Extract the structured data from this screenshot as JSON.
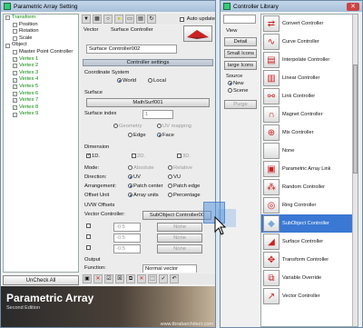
{
  "left_window": {
    "title": "Parametric Array Setting",
    "tree": [
      {
        "label": "Transform",
        "indent": 0,
        "green": true,
        "sel": false,
        "box": "-"
      },
      {
        "label": "Position",
        "indent": 1,
        "green": false,
        "sel": false,
        "box": ""
      },
      {
        "label": "Rotation",
        "indent": 1,
        "green": false,
        "sel": false,
        "box": ""
      },
      {
        "label": "Scale",
        "indent": 1,
        "green": false,
        "sel": false,
        "box": ""
      },
      {
        "label": "Object",
        "indent": 0,
        "green": false,
        "sel": false,
        "box": ""
      },
      {
        "label": "Master Point Controller",
        "indent": 1,
        "green": false,
        "sel": false,
        "box": ""
      },
      {
        "label": "Vertex 1",
        "indent": 1,
        "green": true,
        "sel": false,
        "box": "v"
      },
      {
        "label": "Vertex 2",
        "indent": 1,
        "green": true,
        "sel": false,
        "box": "v"
      },
      {
        "label": "Vertex 3",
        "indent": 1,
        "green": true,
        "sel": false,
        "box": "v"
      },
      {
        "label": "Vertex 4",
        "indent": 1,
        "green": true,
        "sel": false,
        "box": "v"
      },
      {
        "label": "Vertex 5",
        "indent": 1,
        "green": true,
        "sel": false,
        "box": "v"
      },
      {
        "label": "Vertex 6",
        "indent": 1,
        "green": true,
        "sel": false,
        "box": "v"
      },
      {
        "label": "Vertex 7",
        "indent": 1,
        "green": true,
        "sel": false,
        "box": "v"
      },
      {
        "label": "Vertex 8",
        "indent": 1,
        "green": true,
        "sel": false,
        "box": "v"
      },
      {
        "label": "Vertex 9",
        "indent": 1,
        "green": true,
        "sel": false,
        "box": "v"
      }
    ],
    "uncheck_all": "UnCheck All",
    "auto_update": "Auto update",
    "vector_label": "Vector",
    "controller_type": "Surface Controller",
    "controller_name": "Surface Controller002",
    "settings_header": "Controller settings",
    "coord_system": "Coordinate System",
    "coord_world": "World",
    "coord_local": "Local",
    "surface_label": "Surface",
    "surface_value": "MathSurf001",
    "surface_index_label": "Surface index",
    "surface_index_value": "1",
    "geometry": "Geometry",
    "uv_mapping": "UV mapping",
    "edge": "Edge",
    "face": "Face",
    "dimension_label": "Dimension",
    "dim_1d": "1D.",
    "dim_2d": "2D.",
    "dim_3d": "3D.",
    "mode_label": "Mode:",
    "mode_absolute": "Absolute",
    "mode_relative": "Relative",
    "direction_label": "Direction:",
    "dir_uv": "UV",
    "dir_vu": "VU",
    "arrangement_label": "Arrangement:",
    "arr_patch_center": "Patch center",
    "arr_patch_edge": "Patch edge",
    "offset_unit_label": "Offset Unit",
    "off_array_units": "Array units",
    "off_percentage": "Percentage",
    "uvw_offsets": "UVW Offsets",
    "vector_controller_label": "Vector Controller:",
    "vector_controller_value": "SubObject Controller00",
    "offset_rows": [
      {
        "value": "-0.5",
        "none": "None"
      },
      {
        "value": "-0.5",
        "none": "None"
      },
      {
        "value": "-0.5",
        "none": "None"
      }
    ],
    "output_label": "Output",
    "function_label": "Function:",
    "function_value": "Normal vector",
    "banner_title": "Parametric Array",
    "banner_edition": "Second Edition",
    "banner_url": "www.tbrabarchitect.com"
  },
  "right_window": {
    "title": "Controller Library",
    "view_label": "View",
    "detail_btn": "Detail",
    "small_icons_btn": "Small Icons",
    "large_icons_btn": "large Icons",
    "source_label": "Source",
    "source_new": "New",
    "source_scene": "Scene",
    "purge_btn": "Purge",
    "items": [
      {
        "label": "Convert Controller",
        "icon": "convert-controller-icon",
        "glyph": "⇄",
        "sel": false
      },
      {
        "label": "Curve Controller",
        "icon": "curve-controller-icon",
        "glyph": "∿",
        "sel": false
      },
      {
        "label": "Interpolate Controller",
        "icon": "interpolate-controller-icon",
        "glyph": "▤",
        "sel": false
      },
      {
        "label": "Linear Controller",
        "icon": "linear-controller-icon",
        "glyph": "▥",
        "sel": false
      },
      {
        "label": "Link Controller",
        "icon": "link-controller-icon",
        "glyph": "⚯",
        "sel": false
      },
      {
        "label": "Magnet Controller",
        "icon": "magnet-controller-icon",
        "glyph": "∩",
        "sel": false
      },
      {
        "label": "Mix Controller",
        "icon": "mix-controller-icon",
        "glyph": "⊕",
        "sel": false
      },
      {
        "label": "None",
        "icon": "none-controller-icon",
        "glyph": "",
        "sel": false
      },
      {
        "label": "Parametric Array Link",
        "icon": "parametric-array-link-icon",
        "glyph": "▣",
        "sel": false
      },
      {
        "label": "Random Controller",
        "icon": "random-controller-icon",
        "glyph": "⁂",
        "sel": false
      },
      {
        "label": "Ring Controller",
        "icon": "ring-controller-icon",
        "glyph": "◎",
        "sel": false
      },
      {
        "label": "SubObject Controller",
        "icon": "subobject-controller-icon",
        "glyph": "◆",
        "sel": true
      },
      {
        "label": "Surface Controller",
        "icon": "surface-controller-icon",
        "glyph": "◢",
        "sel": false
      },
      {
        "label": "Transform Controller",
        "icon": "transform-controller-icon",
        "glyph": "✥",
        "sel": false
      },
      {
        "label": "Variable Override",
        "icon": "variable-override-icon",
        "glyph": "⧉",
        "sel": false
      },
      {
        "label": "Vector Controller",
        "icon": "vector-controller-icon",
        "glyph": "↗",
        "sel": false
      }
    ]
  }
}
